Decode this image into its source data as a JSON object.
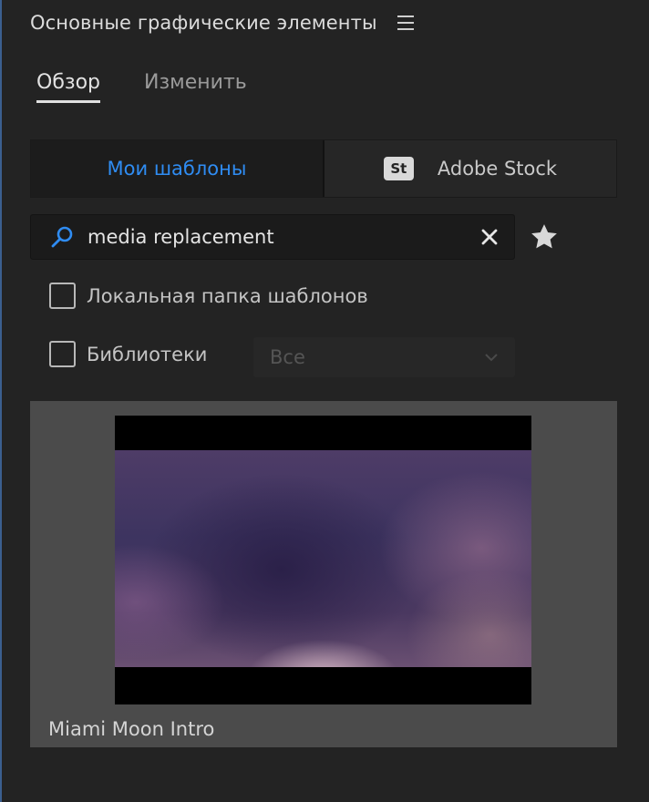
{
  "panel": {
    "title": "Основные графические элементы",
    "menu_icon": "hamburger-menu-icon"
  },
  "tabs": [
    {
      "label": "Обзор",
      "active": true
    },
    {
      "label": "Изменить",
      "active": false
    }
  ],
  "source_switch": {
    "my_templates_label": "Мои шаблоны",
    "adobe_stock_badge": "St",
    "adobe_stock_label": "Adobe Stock",
    "selected": "Мои шаблоны",
    "accent_color": "#2f8cf2"
  },
  "search": {
    "value": "media replacement",
    "search_icon": "search-icon",
    "clear_icon": "close-icon",
    "favorites_icon": "star-icon"
  },
  "filters": {
    "local_folder_label": "Локальная папка шаблонов",
    "local_folder_checked": false,
    "libraries_label": "Библиотеки",
    "libraries_checked": false,
    "libraries_select_value": "Все",
    "libraries_select_disabled": true
  },
  "results": [
    {
      "title": "Miami Moon Intro"
    }
  ]
}
